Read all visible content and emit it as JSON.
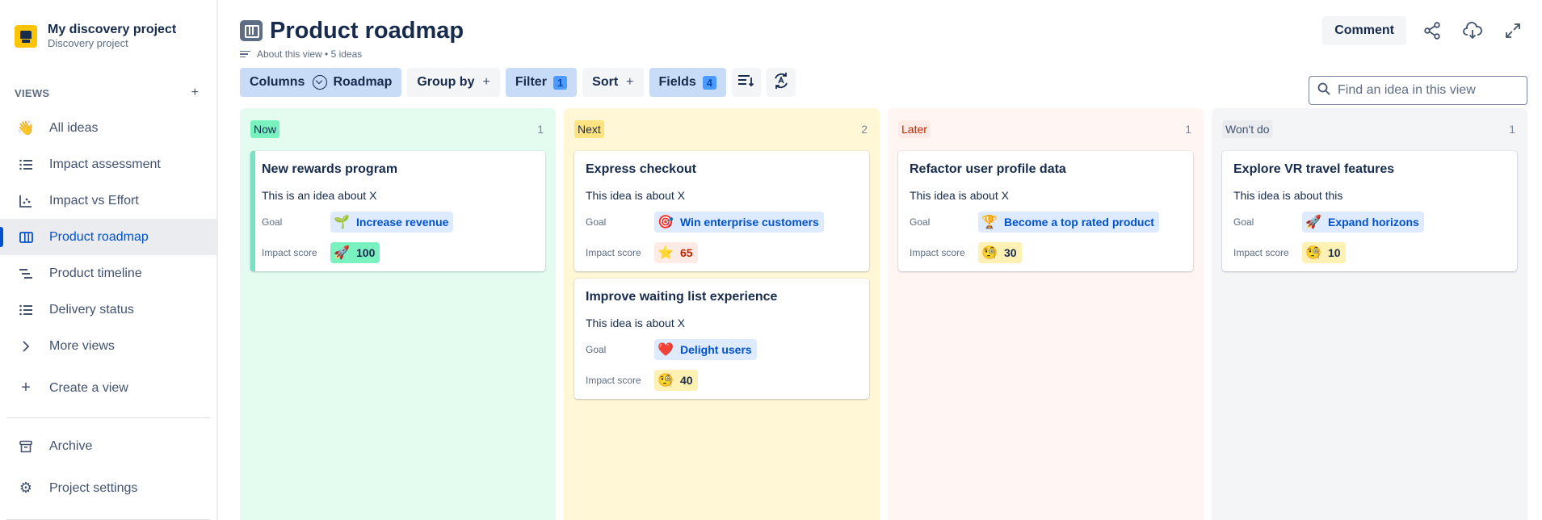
{
  "project": {
    "name": "My discovery project",
    "type": "Discovery project"
  },
  "sidebar": {
    "views_title": "VIEWS",
    "items": [
      {
        "label": "All ideas",
        "icon": "waving-hand-icon"
      },
      {
        "label": "Impact assessment",
        "icon": "list-icon"
      },
      {
        "label": "Impact vs Effort",
        "icon": "scatter-chart-icon"
      },
      {
        "label": "Product roadmap",
        "icon": "board-columns-icon",
        "active": true
      },
      {
        "label": "Product timeline",
        "icon": "timeline-icon"
      },
      {
        "label": "Delivery status",
        "icon": "list-icon"
      },
      {
        "label": "More views",
        "icon": "chevron-right-icon"
      },
      {
        "label": "Create a view",
        "icon": "plus-icon"
      }
    ],
    "archive": "Archive",
    "settings": "Project settings"
  },
  "header": {
    "title": "Product roadmap",
    "about": "About this view • 5 ideas",
    "comment": "Comment"
  },
  "toolbar": {
    "columns_label": "Columns",
    "columns_value": "Roadmap",
    "group_by": "Group by",
    "filter": "Filter",
    "filter_count": "1",
    "sort": "Sort",
    "fields": "Fields",
    "fields_count": "4",
    "plus": "+"
  },
  "search": {
    "placeholder": "Find an idea in this view"
  },
  "labels": {
    "goal": "Goal",
    "impact": "Impact score"
  },
  "colors": {
    "now_bg": "#e3fcef",
    "now_tag": "#79f2c0",
    "next_bg": "#fff7d6",
    "next_tag": "#ffe380",
    "later_bg": "#fff5f3",
    "later_tag": "#ffebe6",
    "wont_bg": "#f4f5f7",
    "wont_tag": "#ebecf0"
  },
  "columns": [
    {
      "name": "Now",
      "count": "1",
      "cards": [
        {
          "title": "New rewards program",
          "desc": "This is an idea about X",
          "goal_emoji": "🌱",
          "goal": "Increase revenue",
          "impact_emoji": "🚀",
          "impact": "100"
        }
      ]
    },
    {
      "name": "Next",
      "count": "2",
      "cards": [
        {
          "title": "Express checkout",
          "desc": "This idea is about X",
          "goal_emoji": "🎯",
          "goal": "Win enterprise customers",
          "impact_emoji": "⭐",
          "impact": "65"
        },
        {
          "title": "Improve waiting list experience",
          "desc": "This idea is about X",
          "goal_emoji": "❤️",
          "goal": "Delight users",
          "impact_emoji": "🧐",
          "impact": "40"
        }
      ]
    },
    {
      "name": "Later",
      "count": "1",
      "cards": [
        {
          "title": "Refactor user profile data",
          "desc": "This idea is about X",
          "goal_emoji": "🏆",
          "goal": "Become a top rated product",
          "impact_emoji": "🧐",
          "impact": "30"
        }
      ]
    },
    {
      "name": "Won't do",
      "count": "1",
      "cards": [
        {
          "title": "Explore VR travel features",
          "desc": "This idea is about this",
          "goal_emoji": "🚀",
          "goal": "Expand horizons",
          "impact_emoji": "🧐",
          "impact": "10"
        }
      ]
    }
  ]
}
